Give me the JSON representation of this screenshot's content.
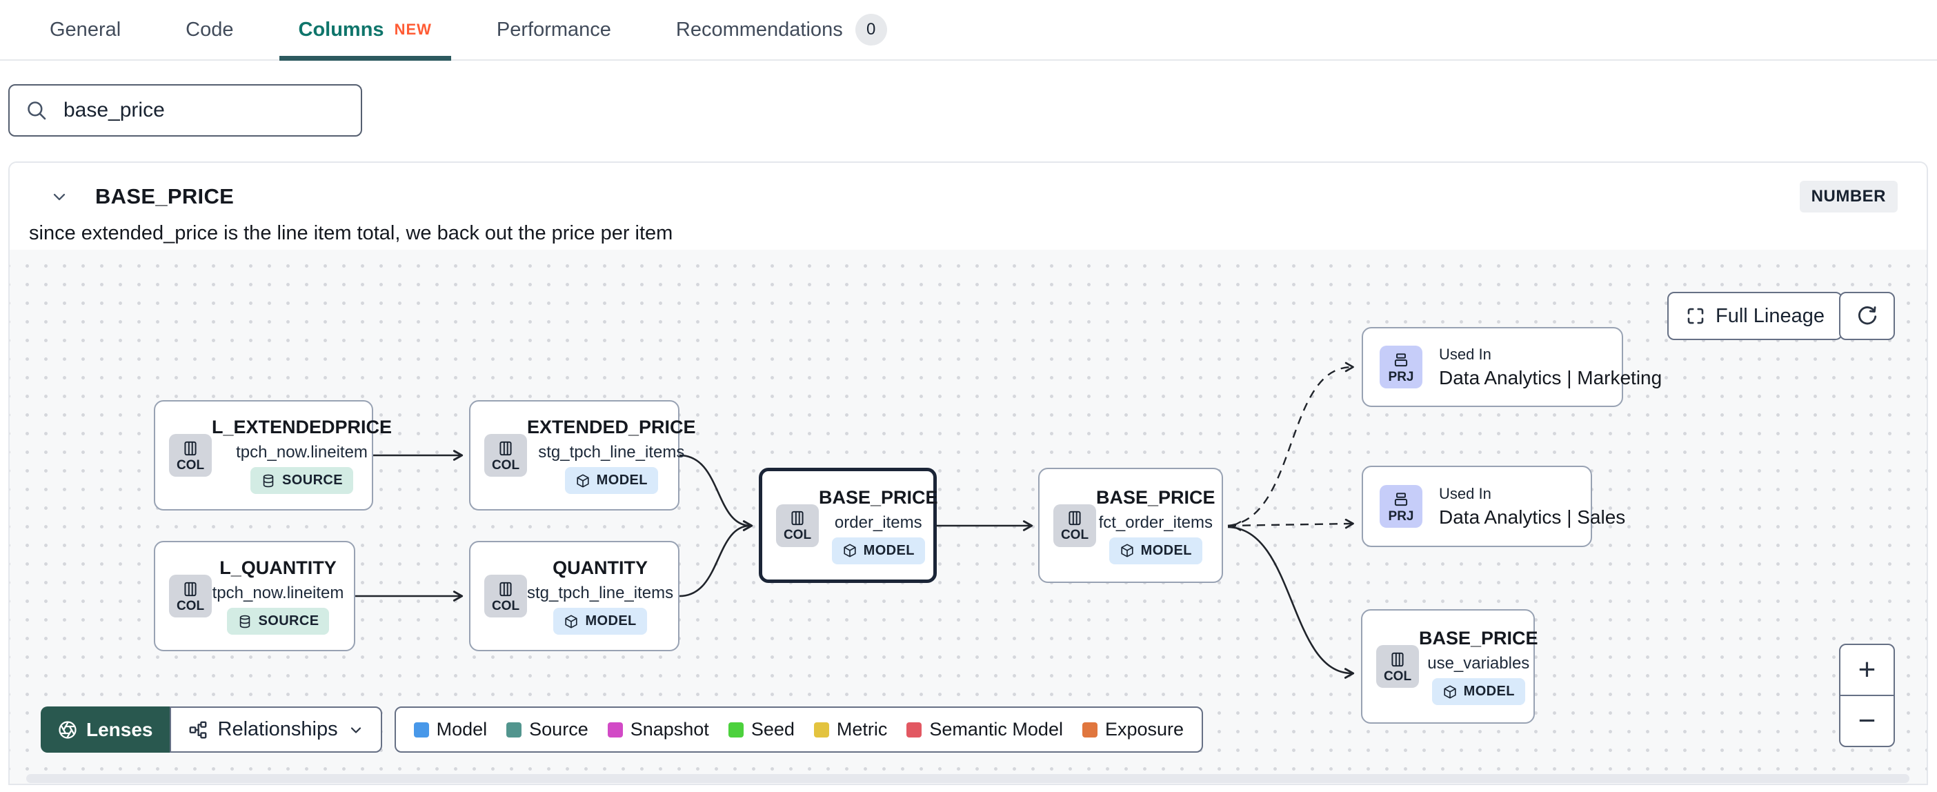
{
  "tabs": {
    "items": [
      {
        "label": "General"
      },
      {
        "label": "Code"
      },
      {
        "label": "Columns",
        "badge": "NEW",
        "active": true
      },
      {
        "label": "Performance"
      },
      {
        "label": "Recommendations",
        "count": "0"
      }
    ]
  },
  "search": {
    "value": "base_price"
  },
  "column_details": {
    "name": "BASE_PRICE",
    "data_type": "NUMBER",
    "description": "since extended_price is the line item total, we back out the price per item"
  },
  "lineage": {
    "controls": {
      "full_lineage": "Full Lineage",
      "zoom_in": "+",
      "zoom_out": "−"
    },
    "toolbar": {
      "lenses": "Lenses",
      "relationships": "Relationships"
    },
    "legend": [
      {
        "label": "Model",
        "color": "#4898e9"
      },
      {
        "label": "Source",
        "color": "#52958e"
      },
      {
        "label": "Snapshot",
        "color": "#d24ac6"
      },
      {
        "label": "Seed",
        "color": "#4cd13d"
      },
      {
        "label": "Metric",
        "color": "#e3c33f"
      },
      {
        "label": "Semantic Model",
        "color": "#e25862"
      },
      {
        "label": "Exposure",
        "color": "#e0763e"
      }
    ],
    "nodes": [
      {
        "badge": "COL",
        "title": "L_EXTENDEDPRICE",
        "subtitle": "tpch_now.lineitem",
        "type": "SOURCE"
      },
      {
        "badge": "COL",
        "title": "EXTENDED_PRICE",
        "subtitle": "stg_tpch_line_items",
        "type": "MODEL"
      },
      {
        "badge": "COL",
        "title": "L_QUANTITY",
        "subtitle": "tpch_now.lineitem",
        "type": "SOURCE"
      },
      {
        "badge": "COL",
        "title": "QUANTITY",
        "subtitle": "stg_tpch_line_items",
        "type": "MODEL"
      },
      {
        "badge": "COL",
        "title": "BASE_PRICE",
        "subtitle": "order_items",
        "type": "MODEL",
        "selected": true
      },
      {
        "badge": "COL",
        "title": "BASE_PRICE",
        "subtitle": "fct_order_items",
        "type": "MODEL"
      },
      {
        "badge": "PRJ",
        "title": "Used In",
        "subtitle": "Data Analytics | Marketing"
      },
      {
        "badge": "PRJ",
        "title": "Used In",
        "subtitle": "Data Analytics | Sales"
      },
      {
        "badge": "COL",
        "title": "BASE_PRICE",
        "subtitle": "use_variables",
        "type": "MODEL"
      }
    ]
  },
  "colors": {
    "active_tab_text": "#0f756b",
    "active_tab_underline": "#2d5a5f",
    "new_badge": "#ff5c35",
    "lenses_background": "#29584f",
    "model_pill": "#d9eafb",
    "source_pill": "#d3ece4",
    "prj_badge": "#c6cdf9",
    "col_badge": "#d2d5dc"
  }
}
